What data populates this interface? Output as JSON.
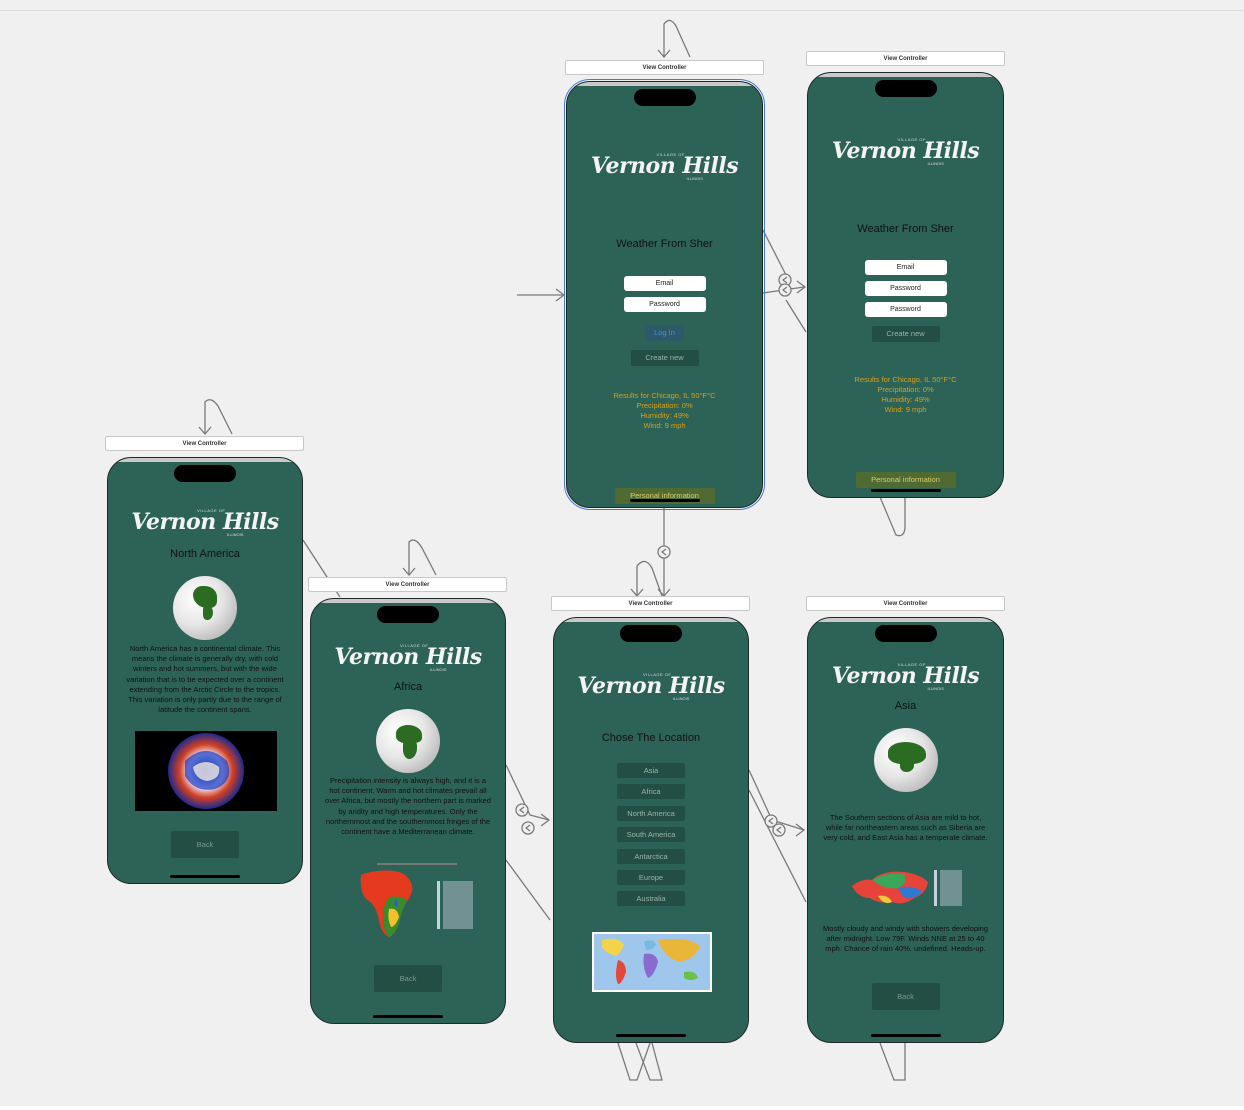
{
  "canvas": {
    "view_controller_label": "View Controller"
  },
  "logo": {
    "village": "VILLAGE OF",
    "name": "Vernon Hills",
    "state": "ILLINOIS"
  },
  "login_screen": {
    "title": "Weather From Sher",
    "email_field": "Email",
    "password_field": "Password",
    "login_button": "Log In",
    "create_button": "Create new",
    "results_line": "Results for Chicago, IL 50°F°C",
    "precipitation": "Precipitation: 0%",
    "humidity": "Humidity: 49%",
    "wind": "Wind: 9 mph",
    "personal_button": "Personal information"
  },
  "signup_screen": {
    "title": "Weather From Sher",
    "email_field": "Email",
    "password_field": "Password",
    "password_confirm_field": "Password",
    "create_button": "Create new",
    "results_line": "Results for Chicago, IL 50°F°C",
    "precipitation": "Precipitation: 0%",
    "humidity": "Humidity: 49%",
    "wind": "Wind: 9 mph",
    "personal_button": "Personal information"
  },
  "north_america_screen": {
    "title": "North America",
    "description": "North America has a continental climate. This means the climate is generally dry, with cold winters and hot summers, but with the wide variation that is to be expected over a continent extending from the Arctic Circle to the tropics. This variation is only partly due to the range of latitude the continent spans.",
    "back_button": "Back"
  },
  "africa_screen": {
    "title": "Africa",
    "description": "Precipitation intensity is always high, and it is a hot continent. Warm and hot climates prevail all over Africa, but mostly the northern part is marked by aridity and high temperatures. Only the northernmost and the southernmost fringes of the continent have a Mediterranean climate.",
    "back_button": "Back"
  },
  "location_screen": {
    "title": "Chose The Location",
    "locations": [
      "Asia",
      "Africa",
      "North America",
      "South America",
      "Antarctica",
      "Europe",
      "Australia"
    ]
  },
  "asia_screen": {
    "title": "Asia",
    "description": "The Southern sections of Asia are mild to hot, while far northeastern areas such as Siberia are very cold, and East Asia has a temperate climate.",
    "forecast": "Mostly cloudy and windy with showers developing after midnight. Low 79F. Winds NNE at 25 to 40 mph. Chance of rain 40%. undefined. Heads-up.",
    "back_button": "Back"
  },
  "colors": {
    "screen_bg": "#2d6356",
    "results_text": "#d4a01d",
    "canvas_bg": "#f0f0f0"
  }
}
